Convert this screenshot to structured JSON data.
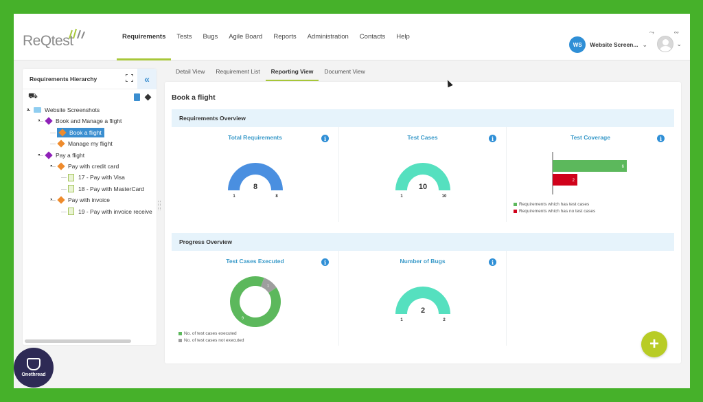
{
  "app": {
    "logo": "ReQtest",
    "nav": [
      "Requirements",
      "Tests",
      "Bugs",
      "Agile Board",
      "Reports",
      "Administration",
      "Contacts",
      "Help"
    ],
    "active_nav": "Requirements",
    "account": {
      "initials": "WS",
      "name": "Website Screen..."
    },
    "accent_color": "#a8c73a",
    "brand_blue": "#2f8fd6"
  },
  "sidebar": {
    "title": "Requirements Hierarchy",
    "tree": [
      {
        "label": "Website Screenshots",
        "type": "folder",
        "level": 0
      },
      {
        "label": "Book and Manage a flight",
        "type": "epic",
        "level": 1
      },
      {
        "label": "Book a flight",
        "type": "requirement",
        "level": 2,
        "selected": true
      },
      {
        "label": "Manage my flight",
        "type": "requirement",
        "level": 2
      },
      {
        "label": "Pay a flight",
        "type": "epic",
        "level": 1
      },
      {
        "label": "Pay with credit card",
        "type": "requirement",
        "level": 2
      },
      {
        "label": "17 - Pay with Visa",
        "type": "file",
        "level": 3
      },
      {
        "label": "18 - Pay with MasterCard",
        "type": "file",
        "level": 3
      },
      {
        "label": "Pay with invoice",
        "type": "requirement",
        "level": 2
      },
      {
        "label": "19 - Pay with invoice receive",
        "type": "file",
        "level": 3
      }
    ]
  },
  "tabs": [
    "Detail View",
    "Requirement List",
    "Reporting View",
    "Document View"
  ],
  "active_tab": "Reporting View",
  "main": {
    "title": "Book a flight",
    "requirements_overview": {
      "heading": "Requirements Overview"
    },
    "progress_overview": {
      "heading": "Progress Overview"
    }
  },
  "chart_data": [
    {
      "type": "gauge",
      "title": "Total Requirements",
      "value": 8,
      "min": 1,
      "max": 8,
      "color": "#4a8fe0",
      "min_label": "1",
      "max_label": "8",
      "value_label": "8"
    },
    {
      "type": "gauge",
      "title": "Test Cases",
      "value": 10,
      "min": 1,
      "max": 10,
      "color": "#55e0bf",
      "min_label": "1",
      "max_label": "10",
      "value_label": "10"
    },
    {
      "type": "bar",
      "orientation": "horizontal",
      "title": "Test Coverage",
      "categories": [
        "Requirements which has test cases",
        "Requirements which has no test cases"
      ],
      "values": [
        6,
        2
      ],
      "colors": [
        "#5cb85c",
        "#d0021b"
      ],
      "value_labels": [
        "6",
        "2"
      ],
      "legend": "bottom-left"
    },
    {
      "type": "pie",
      "donut": true,
      "title": "Test Cases Executed",
      "categories": [
        "No. of test cases executed",
        "No. of test cases not executed"
      ],
      "values": [
        9,
        1
      ],
      "colors": [
        "#5cb85c",
        "#9e9e9e"
      ],
      "value_labels": [
        "9",
        "1"
      ],
      "legend": "bottom-left"
    },
    {
      "type": "gauge",
      "title": "Number of Bugs",
      "value": 2,
      "min": 1,
      "max": 2,
      "color": "#55e0bf",
      "min_label": "1",
      "max_label": "2",
      "value_label": "2"
    }
  ],
  "fab_label": "+",
  "watermark": "Onethread"
}
